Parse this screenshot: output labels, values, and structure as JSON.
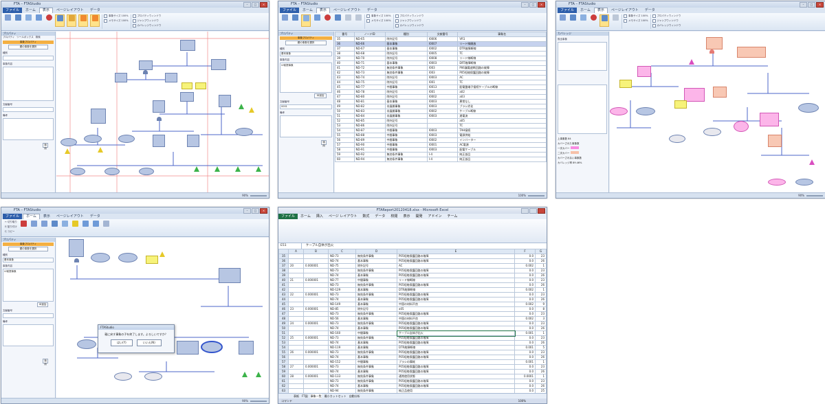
{
  "shots": {
    "s1": {
      "title": "FTA – FTAStudio",
      "menus": [
        "ファイル",
        "ホーム",
        "表示",
        "ページレイアウト",
        "データ"
      ],
      "ribbon_groups": [
        "表示切り替え",
        "表示",
        "ズーム",
        "ウィンドウ"
      ],
      "panel": {
        "header": "プロパティ",
        "tabs": [
          "プロパティ",
          "ツールボックス",
          "検索"
        ],
        "orange": "事象プロパティ",
        "btn": "親の事象を選択",
        "field_labels": [
          "種別",
          "事象内容",
          "文献番号",
          "備考"
        ],
        "apply": "適用"
      },
      "status": {
        "zoom": "90%"
      }
    },
    "s2": {
      "title": "FTA – FTAStudio",
      "menus": [
        "ファイル",
        "ホーム",
        "表示",
        "ページレイアウト",
        "データ"
      ],
      "panel": {
        "header": "プロパティ",
        "orange": "事象プロパティ",
        "btn": "親の事象を選択",
        "field_labels": [
          "種別",
          "基本事象",
          "事象内容",
          "UI前提事象",
          "文献番号",
          "0001",
          "備考"
        ],
        "btn2": "ID追加",
        "apply": "適用"
      },
      "table_headers": [
        "番号",
        "ノードID",
        "種別",
        "文献番号",
        "事象名"
      ],
      "rows": [
        [
          "35",
          "ND-65",
          "除外記号",
          "I0006",
          "VR1"
        ],
        [
          "36",
          "ND-66",
          "基本事象",
          "I0007",
          "リード線開放"
        ],
        [
          "37",
          "ND-67",
          "基本事象",
          "I0002",
          "DTR故障断線"
        ],
        [
          "38",
          "ND-68",
          "除外記号",
          "I0005",
          "TC"
        ],
        [
          "39",
          "ND-70",
          "除外記号",
          "I0008",
          "リード線断線"
        ],
        [
          "40",
          "ND-71",
          "基本事象",
          "I0003",
          "DRT故障断線"
        ],
        [
          "41",
          "ND-72",
          "無効条件事象",
          "I003",
          "P06漏電遮断回路の故障"
        ],
        [
          "42",
          "ND-73",
          "無効条件事象",
          "I003",
          "P05短絡保護回路の故障"
        ],
        [
          "43",
          "ND-74",
          "除外記号",
          "I0003",
          "AC"
        ],
        [
          "44",
          "ND-75",
          "除外記号",
          "I001",
          "TC"
        ],
        [
          "45",
          "ND-77",
          "中間事象",
          "I0013",
          "配電盤端子接続ケーブルの断線"
        ],
        [
          "46",
          "ND-78",
          "除外記号",
          "I001",
          "a02"
        ],
        [
          "47",
          "ND-80",
          "除外記号",
          "I0002",
          "a03"
        ],
        [
          "48",
          "ND-81",
          "基本事象",
          "I0003",
          "異常なし"
        ],
        [
          "49",
          "ND-82",
          "非展開事象",
          "I0003",
          "ブラシ劣化"
        ],
        [
          "50",
          "ND-83",
          "非展開事象",
          "I0002",
          "ケーブル断線"
        ],
        [
          "51",
          "ND-84",
          "非展開事象",
          "I0003",
          "過電流"
        ],
        [
          "52",
          "ND-85",
          "除外記号",
          "",
          "a05"
        ],
        [
          "53",
          "ND-86",
          "除外記号",
          "",
          "TC"
        ],
        [
          "54",
          "ND-87",
          "中間事象",
          "I0003",
          "TAH接続"
        ],
        [
          "55",
          "ND-88",
          "中間事象",
          "I0003",
          "電源供給"
        ],
        [
          "56",
          "ND-89",
          "中間事象",
          "I0002",
          "インバーター"
        ],
        [
          "57",
          "ND-90",
          "中間事象",
          "I0001",
          "AC電源"
        ],
        [
          "58",
          "ND-91",
          "中間事象",
          "I0003",
          "配電ケーブル"
        ],
        [
          "59",
          "ND-92",
          "無効条件事象",
          "I-4",
          "純正部品"
        ],
        [
          "60",
          "ND-94",
          "無効条件事象",
          "I-4",
          "純正部品"
        ]
      ],
      "status": {
        "zoom": "100%"
      }
    },
    "s3": {
      "title": "FTA – FTAStudio",
      "menus": [
        "ファイル",
        "ホーム",
        "表示",
        "ページレイアウト",
        "データ"
      ],
      "panel": {
        "header": "カバレッジ",
        "list_title": "既出事象",
        "legend": [
          "上事象数",
          "カバーされた事象数",
          "一次カバー",
          "二次カバー",
          "カバーされない事象数",
          "カバレッジ率"
        ],
        "values": [
          "84",
          "",
          "",
          "",
          "",
          "89.46%"
        ]
      },
      "status": {
        "zoom": "90%"
      }
    },
    "s4": {
      "title": "FTA – FTAStudio",
      "menus": [
        "ファイル",
        "ホーム",
        "表示",
        "ページレイアウト",
        "データ"
      ],
      "dialog": {
        "title": "FTAStudio",
        "message": "親に戻す事象の子を終了します。よろしいですか？",
        "ok": "はい(Y)",
        "cancel": "いいえ(N)"
      },
      "panel": {
        "header": "プロパティ",
        "orange": "事象プロパティ",
        "btn": "親の事象を選択",
        "field_labels": [
          "種別",
          "基本事象",
          "事象内容",
          "UI前提事象",
          "文献番号",
          "備考"
        ],
        "btn2": "ID追加",
        "apply": "適用"
      },
      "status": {
        "zoom": "90%"
      }
    },
    "s5": {
      "title": "FTAReport20120418.xlsx - Microsoft Excel",
      "menus": [
        "ファイル",
        "ホーム",
        "挿入",
        "ページ レイアウト",
        "数式",
        "データ",
        "校閲",
        "表示",
        "開発",
        "アドイン",
        "チーム"
      ],
      "name_box": "E51",
      "formula": "ケーブル自体が出火",
      "col_headers": [
        "A",
        "B",
        "C",
        "D",
        "E",
        "F",
        "G"
      ],
      "rows": [
        [
          "35",
          "",
          "",
          "ND-73",
          "無効条件事象",
          "P05短絡保護回路の故障",
          "0.0",
          "23"
        ],
        [
          "36",
          "",
          "",
          "ND-74",
          "基本事象",
          "P05短絡保護回路の故障",
          "0.0",
          "26"
        ],
        [
          "37",
          "20",
          "0.000001",
          "ND-75",
          "除外記号",
          "AC",
          "0.002",
          "1"
        ],
        [
          "38",
          "",
          "",
          "ND-73",
          "無効条件事象",
          "P05短絡保護回路の故障",
          "0.0",
          "23"
        ],
        [
          "39",
          "",
          "",
          "ND-74",
          "基本事象",
          "P05短絡保護回路の故障",
          "0.0",
          "26"
        ],
        [
          "40",
          "21",
          "0.000001",
          "ND-77",
          "中間事象",
          "リード線断線",
          "0.0",
          "23"
        ],
        [
          "41",
          "",
          "",
          "ND-73",
          "無効条件事象",
          "P05短絡保護回路の故障",
          "0.0",
          "26"
        ],
        [
          "42",
          "",
          "",
          "ND-129",
          "基本事象",
          "DTR故障断線",
          "0.002",
          "1"
        ],
        [
          "43",
          "22",
          "0.000001",
          "ND-73",
          "無効条件事象",
          "P05短絡保護回路の故障",
          "0.0",
          "23"
        ],
        [
          "44",
          "",
          "",
          "ND-74",
          "基本事象",
          "P05短絡保護回路の故障",
          "0.0",
          "26"
        ],
        [
          "45",
          "",
          "",
          "ND-149",
          "基本事象",
          "中国の材料不良",
          "0.002",
          "9"
        ],
        [
          "46",
          "23",
          "0.000001",
          "ND-85",
          "除外記号",
          "a05",
          "0.0",
          "8"
        ],
        [
          "47",
          "",
          "",
          "ND-73",
          "無効条件事象",
          "P05短絡保護回路の故障",
          "0.0",
          "23"
        ],
        [
          "48",
          "",
          "",
          "ND-56",
          "基本事象",
          "中国の材料不良",
          "0.002",
          "3"
        ],
        [
          "49",
          "24",
          "0.000001",
          "ND-73",
          "無効条件事象",
          "P05短絡保護回路の故障",
          "0.0",
          "23"
        ],
        [
          "50",
          "",
          "",
          "ND-74",
          "基本事象",
          "P05短絡保護回路の故障",
          "0.0",
          "26"
        ],
        [
          "51",
          "",
          "",
          "ND-160",
          "中間事象",
          "ケーブル自体が出火",
          "0.001",
          "1"
        ],
        [
          "52",
          "25",
          "0.000001",
          "ND-73",
          "無効条件事象",
          "P05短絡保護回路の故障",
          "0.0",
          "23"
        ],
        [
          "53",
          "",
          "",
          "ND-74",
          "基本事象",
          "P05短絡保護回路の故障",
          "0.0",
          "26"
        ],
        [
          "54",
          "",
          "",
          "ND-119",
          "基本事象",
          "DTR故障断線",
          "0.001",
          "5"
        ],
        [
          "55",
          "26",
          "0.000001",
          "ND-73",
          "無効条件事象",
          "P05短絡保護回路の故障",
          "0.0",
          "23"
        ],
        [
          "56",
          "",
          "",
          "ND-74",
          "基本事象",
          "P05短絡保護回路の故障",
          "0.0",
          "26"
        ],
        [
          "57",
          "",
          "",
          "ND-152",
          "中間事象",
          "ブラシの摩耗",
          "0.001",
          "1"
        ],
        [
          "58",
          "27",
          "0.000001",
          "ND-73",
          "無効条件事象",
          "P05短絡保護回路の故障",
          "0.0",
          "23"
        ],
        [
          "59",
          "",
          "",
          "ND-74",
          "基本事象",
          "P05短絡保護回路の故障",
          "0.0",
          "26"
        ],
        [
          "60",
          "28",
          "0.000001",
          "ND-133",
          "無効条件事象",
          "通常使用状態",
          "0.0001",
          "1"
        ],
        [
          "61",
          "",
          "",
          "ND-73",
          "無効条件事象",
          "P05短絡保護回路の故障",
          "0.0",
          "23"
        ],
        [
          "62",
          "",
          "",
          "ND-74",
          "基本事象",
          "P05短絡保護回路の故障",
          "0.0",
          "26"
        ],
        [
          "63",
          "",
          "",
          "ND-94",
          "無効条件事象",
          "純正品使用",
          "0.0",
          "25"
        ]
      ],
      "sheets": [
        "表紙",
        "FT図",
        "事象一覧",
        "最小カットセット",
        "自動分析"
      ],
      "status": "コマンド",
      "zoom": "100%"
    }
  }
}
